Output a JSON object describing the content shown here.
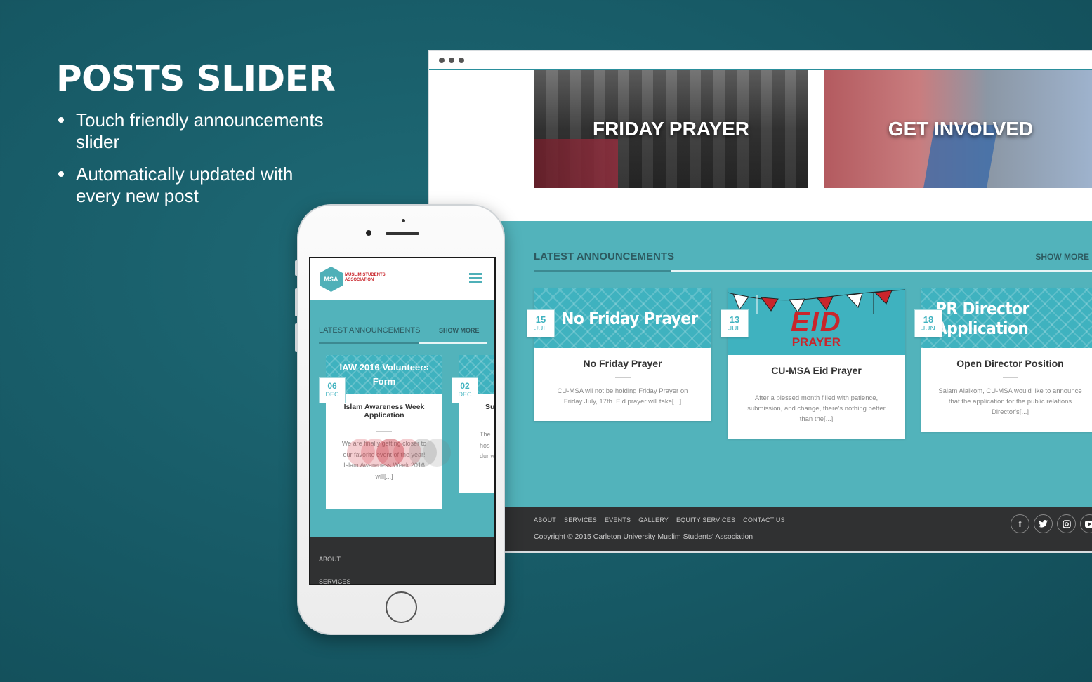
{
  "promo": {
    "title": "POSTS SLIDER",
    "bullets": [
      "Touch friendly announcements slider",
      "Automatically updated with every new post"
    ]
  },
  "desktop": {
    "hero_cards": [
      "FRIDAY PRAYER",
      "GET INVOLVED"
    ],
    "announcements": {
      "heading": "LATEST ANNOUNCEMENTS",
      "show_more": "SHOW MORE",
      "cards": [
        {
          "image_text": "No Friday Prayer",
          "day": "15",
          "month": "JUL",
          "title": "No Friday Prayer",
          "excerpt": "CU-MSA wil not be holding Friday Prayer on Friday July, 17th. Eid prayer will take[...]"
        },
        {
          "image_text_main": "EID",
          "image_text_sub": "PRAYER",
          "day": "13",
          "month": "JUL",
          "title": "CU-MSA Eid Prayer",
          "excerpt": "After a blessed month filled with patience, submission, and change, there's nothing better than the[...]"
        },
        {
          "image_text": "PR Director Application",
          "day": "18",
          "month": "JUN",
          "title": "Open Director Position",
          "excerpt": "Salam Alaikom, CU-MSA would like to announce that the application for the public relations Director's[...]"
        }
      ]
    },
    "footer": {
      "nav": [
        "ABOUT",
        "SERVICES",
        "EVENTS",
        "GALLERY",
        "EQUITY SERVICES",
        "CONTACT US"
      ],
      "copyright": "Copyright © 2015 Carleton University Muslim Students' Association",
      "social_icons": [
        "facebook-icon",
        "twitter-icon",
        "instagram-icon",
        "youtube-icon"
      ]
    }
  },
  "mobile": {
    "logo_text": "MSA",
    "logo_subtitle": "MUSLIM STUDENTS' ASSOCIATION",
    "announcements": {
      "heading": "LATEST ANNOUNCEMENTS",
      "show_more": "SHOW MORE",
      "card": {
        "image_line1": "IAW 2016 Volunteers",
        "image_line2": "Form",
        "day": "06",
        "month": "DEC",
        "title": "Islam Awareness Week Application",
        "excerpt": "We are finally getting closer to our favorite event of the year! Islam Awareness Week 2016 will[...]"
      },
      "card2": {
        "day": "02",
        "month": "DEC",
        "title_partial": "Su",
        "text_partial": "The hos dur w"
      }
    },
    "footer": [
      "ABOUT",
      "SERVICES"
    ]
  },
  "colors": {
    "background": "#175a66",
    "accent_teal": "#52b3bb",
    "footer_dark": "#303132",
    "brand_red": "#c9252b"
  }
}
